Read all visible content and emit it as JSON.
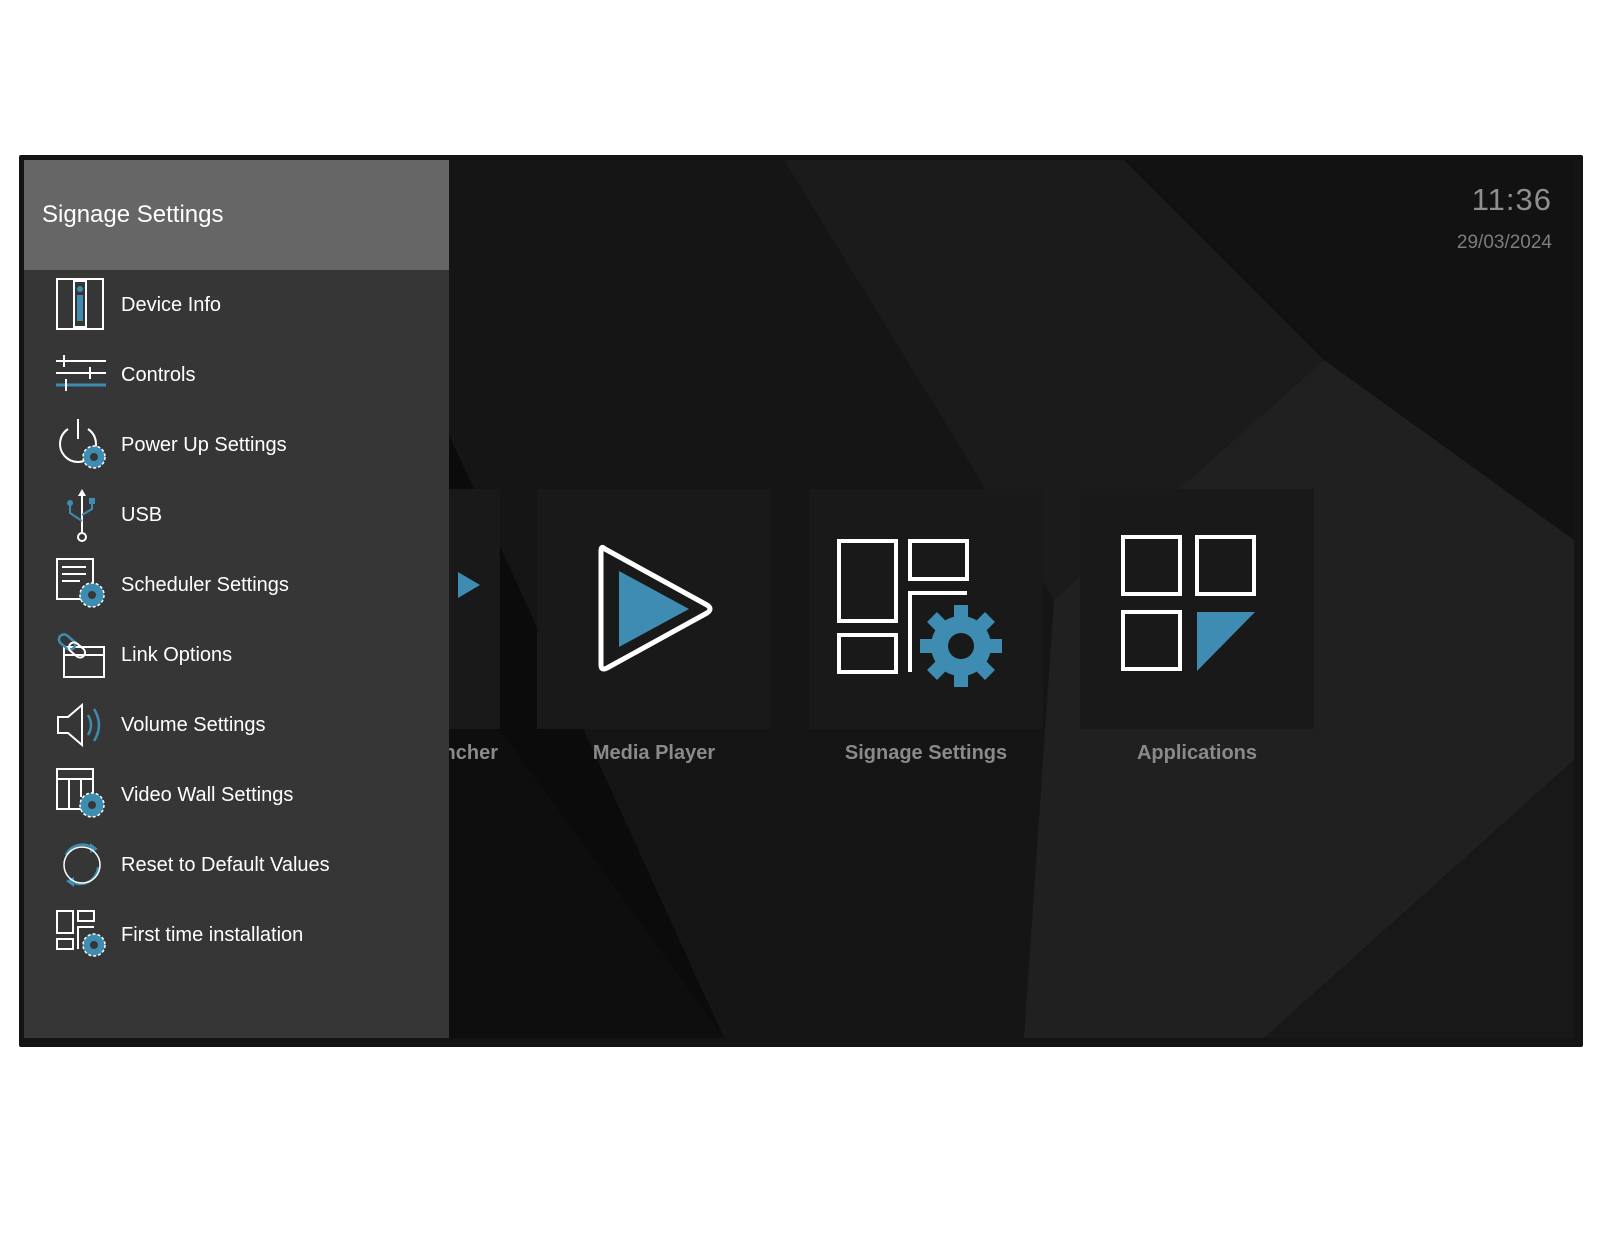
{
  "status": {
    "time": "11:36",
    "date": "29/03/2024"
  },
  "menu": {
    "title": "Signage Settings",
    "items": [
      {
        "label": "Device Info",
        "icon": "info-icon"
      },
      {
        "label": "Controls",
        "icon": "sliders-icon"
      },
      {
        "label": "Power Up Settings",
        "icon": "power-gear-icon"
      },
      {
        "label": "USB",
        "icon": "usb-icon"
      },
      {
        "label": "Scheduler Settings",
        "icon": "document-gear-icon"
      },
      {
        "label": "Link Options",
        "icon": "link-window-icon"
      },
      {
        "label": "Volume Settings",
        "icon": "speaker-icon"
      },
      {
        "label": "Video Wall Settings",
        "icon": "grid-gear-icon"
      },
      {
        "label": "Reset to Default Values",
        "icon": "refresh-icon"
      },
      {
        "label": "First time installation",
        "icon": "layout-gear-icon"
      }
    ]
  },
  "apps": [
    {
      "label": "ncher",
      "icon": "launcher-icon"
    },
    {
      "label": "Media Player",
      "icon": "play-icon"
    },
    {
      "label": "Signage Settings",
      "icon": "layout-gear-icon"
    },
    {
      "label": "Applications",
      "icon": "apps-grid-icon"
    }
  ],
  "colors": {
    "accent": "#3e8cb1",
    "menu_bg": "#363636",
    "menu_header_bg": "#666666",
    "tile_bg": "#191919",
    "screen_bg": "#0b0b0b"
  }
}
